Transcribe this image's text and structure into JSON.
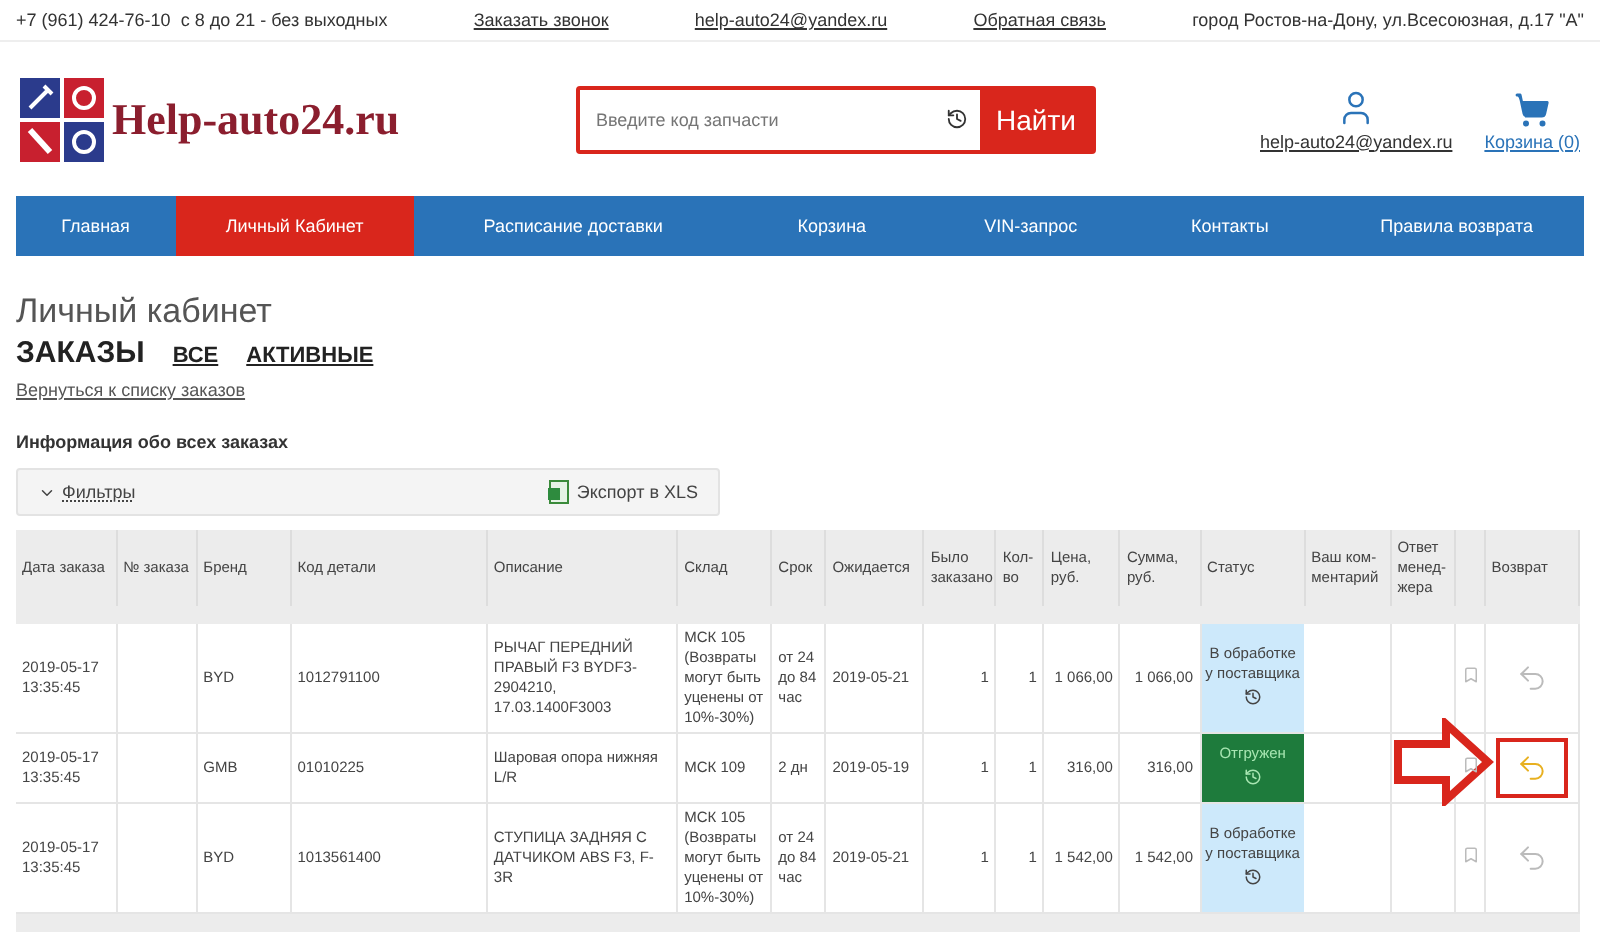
{
  "top_bar": {
    "phone": "+7 (961) 424-76-10",
    "hours": "с 8 до 21 - без выходных",
    "callback_link": "Заказать звонок",
    "email": "help-auto24@yandex.ru",
    "feedback_link": "Обратная связь",
    "address": "город Ростов-на-Дону, ул.Всесоюзная, д.17 \"А\""
  },
  "header": {
    "logo_text": "Help-auto24.ru",
    "search": {
      "placeholder": "Введите код запчасти",
      "button": "Найти"
    },
    "account_email": "help-auto24@yandex.ru",
    "cart_label": "Корзина (0)"
  },
  "nav": [
    {
      "label": "Главная",
      "selected": false
    },
    {
      "label": "Личный Кабинет",
      "selected": true
    },
    {
      "label": "Расписание доставки",
      "selected": false
    },
    {
      "label": "Корзина",
      "selected": false
    },
    {
      "label": "VIN-запрос",
      "selected": false
    },
    {
      "label": "Контакты",
      "selected": false
    },
    {
      "label": "Правила возврата",
      "selected": false
    }
  ],
  "page": {
    "title": "Личный кабинет",
    "section": "ЗАКАЗЫ",
    "filter_links": [
      "ВСЕ",
      "АКТИВНЫЕ"
    ],
    "back_link": "Вернуться к списку заказов",
    "info_heading": "Информация обо всех заказах"
  },
  "toolbar": {
    "filters": "Фильтры",
    "export": "Экспорт в XLS"
  },
  "table": {
    "columns": [
      {
        "kind": "text",
        "label": "Дата заказа"
      },
      {
        "kind": "text",
        "label": "№ заказа"
      },
      {
        "kind": "text",
        "label": "Бренд"
      },
      {
        "kind": "text",
        "label": "Код детали"
      },
      {
        "kind": "text",
        "label": "Описание"
      },
      {
        "kind": "text",
        "label": "Склад"
      },
      {
        "kind": "text",
        "label": "Срок"
      },
      {
        "kind": "text",
        "label": "Ожидается"
      },
      {
        "kind": "text",
        "label": "Было заказано"
      },
      {
        "kind": "text",
        "label": "Кол-во"
      },
      {
        "kind": "text",
        "label": "Цена, руб."
      },
      {
        "kind": "text",
        "label": "Сумма, руб."
      },
      {
        "kind": "text",
        "label": "Статус"
      },
      {
        "kind": "text",
        "label": "Ваш ком-ментарий"
      },
      {
        "kind": "text",
        "label": "Ответ менед-жера"
      },
      {
        "kind": "bookmark"
      },
      {
        "kind": "text",
        "label": "Возврат"
      }
    ],
    "rows": [
      {
        "date": "2019-05-17 13:35:45",
        "brand": "BYD",
        "code": "1012791100",
        "description": "РЫЧАГ ПЕРЕДНИЙ ПРАВЫЙ F3 BYDF3-2904210, 17.03.1400F3003",
        "warehouse": "МСК 105 (Возвраты могут быть уценены от 10%-30%)",
        "term": "от 24 до 84 час",
        "expected": "2019-05-21",
        "ordered": "1",
        "qty": "1",
        "price": "1 066,00",
        "sum": "1 066,00",
        "status": {
          "kind": "processing",
          "label": "В обработке у поставщика"
        },
        "return_highlighted": false
      },
      {
        "date": "2019-05-17 13:35:45",
        "brand": "GMB",
        "code": "01010225",
        "description": "Шаровая опора нижняя L/R",
        "warehouse": "МСК 109",
        "term": "2 дн",
        "expected": "2019-05-19",
        "ordered": "1",
        "qty": "1",
        "price": "316,00",
        "sum": "316,00",
        "status": {
          "kind": "shipped",
          "label": "Отгружен"
        },
        "return_highlighted": true
      },
      {
        "date": "2019-05-17 13:35:45",
        "brand": "BYD",
        "code": "1013561400",
        "description": "СТУПИЦА ЗАДНЯЯ С ДАТЧИКОМ ABS F3, F-3R",
        "warehouse": "МСК 105 (Возвраты могут быть уценены от 10%-30%)",
        "term": "от 24 до 84 час",
        "expected": "2019-05-21",
        "ordered": "1",
        "qty": "1",
        "price": "1 542,00",
        "sum": "1 542,00",
        "status": {
          "kind": "processing",
          "label": "В обработке у поставщика"
        },
        "return_highlighted": false
      }
    ]
  }
}
